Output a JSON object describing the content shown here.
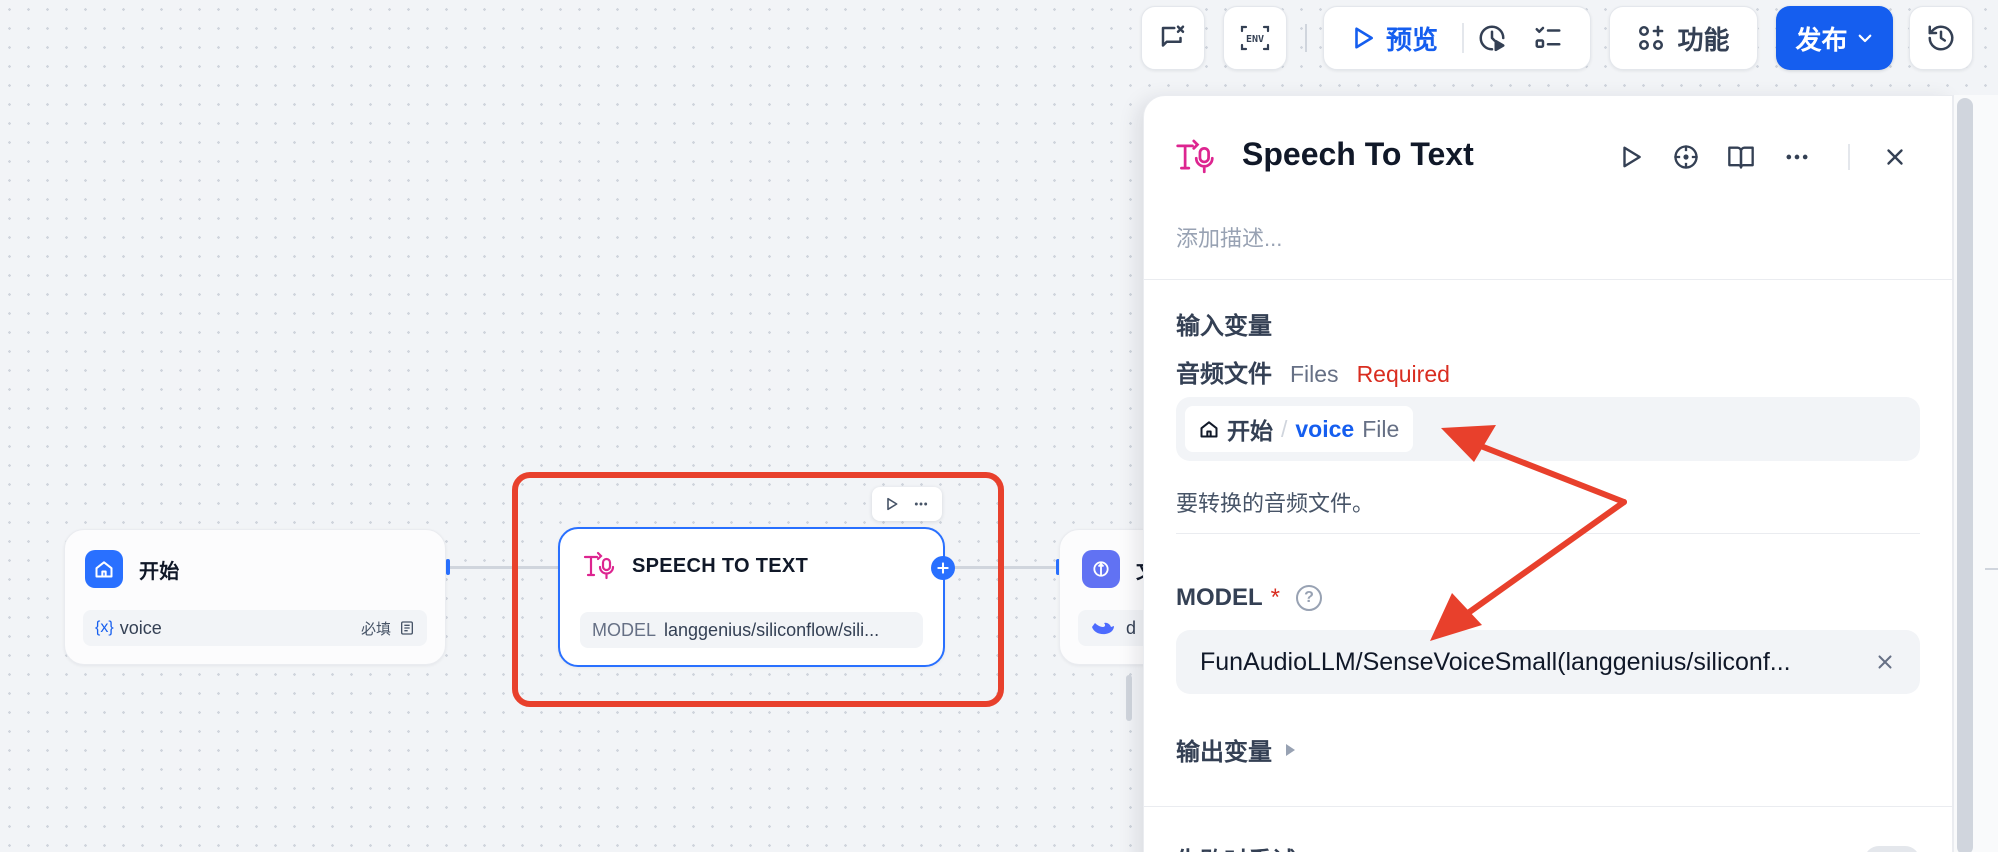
{
  "toolbar": {
    "preview_label": "预览",
    "features_label": "功能",
    "publish_label": "发布",
    "icons": [
      "checklist-chat-icon",
      "env-icon",
      "run-history-icon",
      "checklist-icon",
      "history-icon"
    ],
    "env_text": "ENV"
  },
  "canvas": {
    "start_node": {
      "title": "开始",
      "var_icon": "{x}",
      "var_name": "voice",
      "required_label": "必填"
    },
    "speech_node": {
      "title": "SPEECH TO TEXT",
      "model_label": "MODEL",
      "model_value": "langgenius/siliconflow/sili..."
    },
    "next_node": {
      "title_partial": "文",
      "row_partial": "d"
    }
  },
  "panel": {
    "title": "Speech To Text",
    "description_placeholder": "添加描述...",
    "input_section_title": "输入变量",
    "audio_label": "音频文件",
    "audio_type": "Files",
    "audio_required": "Required",
    "var_source": "开始",
    "var_separator": "/",
    "var_name": "voice",
    "var_type": "File",
    "audio_hint": "要转换的音频文件。",
    "model_label": "MODEL",
    "model_required_mark": "*",
    "model_value": "FunAudioLLM/SenseVoiceSmall(langgenius/siliconf...",
    "output_section_title": "输出变量",
    "bottom_partial": "失败时重试"
  },
  "colors": {
    "accent": "#155eef",
    "highlight": "#e8402c",
    "speech_icon": "#dd2590",
    "required": "#d92d20"
  }
}
